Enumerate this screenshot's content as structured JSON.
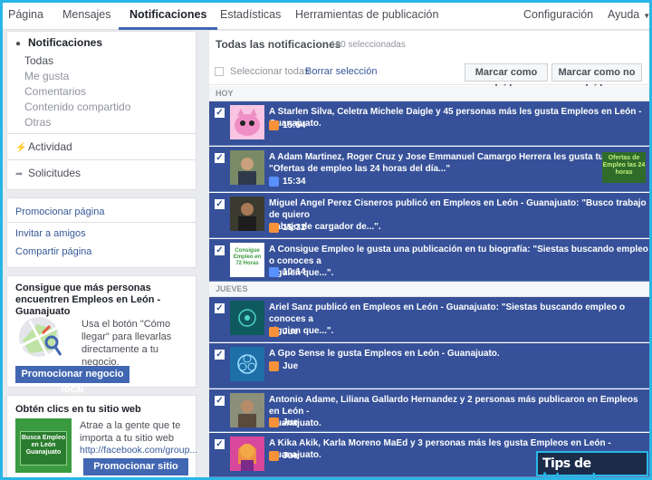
{
  "topbar": {
    "tabs": [
      {
        "label": "Página"
      },
      {
        "label": "Mensajes"
      },
      {
        "label": "Notificaciones"
      },
      {
        "label": "Estadísticas"
      },
      {
        "label": "Herramientas de publicación"
      },
      {
        "label": "Configuración"
      },
      {
        "label": "Ayuda"
      }
    ]
  },
  "sidebar": {
    "section_title": "Notificaciones",
    "subitems": [
      {
        "label": "Todas"
      },
      {
        "label": "Me gusta"
      },
      {
        "label": "Comentarios"
      },
      {
        "label": "Contenido compartido"
      },
      {
        "label": "Otras"
      }
    ],
    "activity": "Actividad",
    "requests": "Solicitudes",
    "links": {
      "promote_page": "Promocionar página",
      "invite_friends": "Invitar a amigos",
      "share_page": "Compartir página"
    }
  },
  "promo_local": {
    "title": "Consigue que más personas encuentren Empleos en León - Guanajuato",
    "body": "Usa el botón \"Cómo llegar\" para llevarlas directamente a tu negocio.",
    "button": "Promocionar negocio local"
  },
  "promo_web": {
    "title": "Obtén clics en tu sitio web",
    "body": "Atrae a la gente que te importa a tu sitio web",
    "url": "http://facebook.com/group...",
    "button": "Promocionar sitio web",
    "image_text": "Busca Empleo en León Guanajuato"
  },
  "main": {
    "title": "Todas las notificaciones",
    "selected_count": "100 seleccionadas",
    "select_all": "Seleccionar todas",
    "clear_selection": "Borrar selección",
    "mark_read": "Marcar como leída",
    "mark_unread": "Marcar como no leída",
    "sections": [
      {
        "label": "HOY",
        "items": [
          {
            "line1": "A Starlen Silva, Celetra Michele Daigle y 45 personas más les gusta Empleos en León - Guanajuato.",
            "line2": "",
            "time": "15:54",
            "icon": "page-icon"
          },
          {
            "line1": "A Adam Martinez, Roger Cruz y Jose Emmanuel Camargo Herrera les gusta tu enlace:",
            "line2": "\"Ofertas de empleo las 24 horas del día...\"",
            "time": "15:34",
            "icon": "like-icon",
            "side_image_text": "Ofertas de Empleo las 24 horas"
          },
          {
            "line1": "Miguel Angel Perez Cisneros publicó en Empleos en León - Guanajuato: \"Busco trabajo de quiero",
            "line2": "trabajo de cargador de...\".",
            "time": "15:32",
            "icon": "page-icon"
          },
          {
            "line1": "A Consigue Empleo le gusta una publicación en tu biografía: \"Siestas buscando empleo o conoces a",
            "line2": "alguien que...\".",
            "time": "10:14",
            "icon": "like-icon",
            "thumb_text": "Consigue Empleo en 72 Horas"
          }
        ]
      },
      {
        "label": "JUEVES",
        "items": [
          {
            "line1": "Ariel Sanz publicó en Empleos en León - Guanajuato: \"Siestas buscando empleo o conoces a",
            "line2": "alguien que...\".",
            "time": "Jue",
            "icon": "page-icon"
          },
          {
            "line1": "A Gpo Sense le gusta Empleos en León - Guanajuato.",
            "line2": "",
            "time": "Jue",
            "icon": "page-icon"
          },
          {
            "line1": "Antonio Adame, Liliana Gallardo Hernandez y 2 personas más publicaron en Empleos en León -",
            "line2": "Guanajuato.",
            "time": "Jue",
            "icon": "page-icon"
          },
          {
            "line1": "A Kika Akik, Karla Moreno MaEd y 3 personas más les gusta Empleos en León - Guanajuato.",
            "line2": "",
            "time": "Jue",
            "icon": "page-icon"
          }
        ]
      }
    ]
  },
  "watermark": {
    "part1": "Tips de ",
    "part2": "Internet"
  }
}
